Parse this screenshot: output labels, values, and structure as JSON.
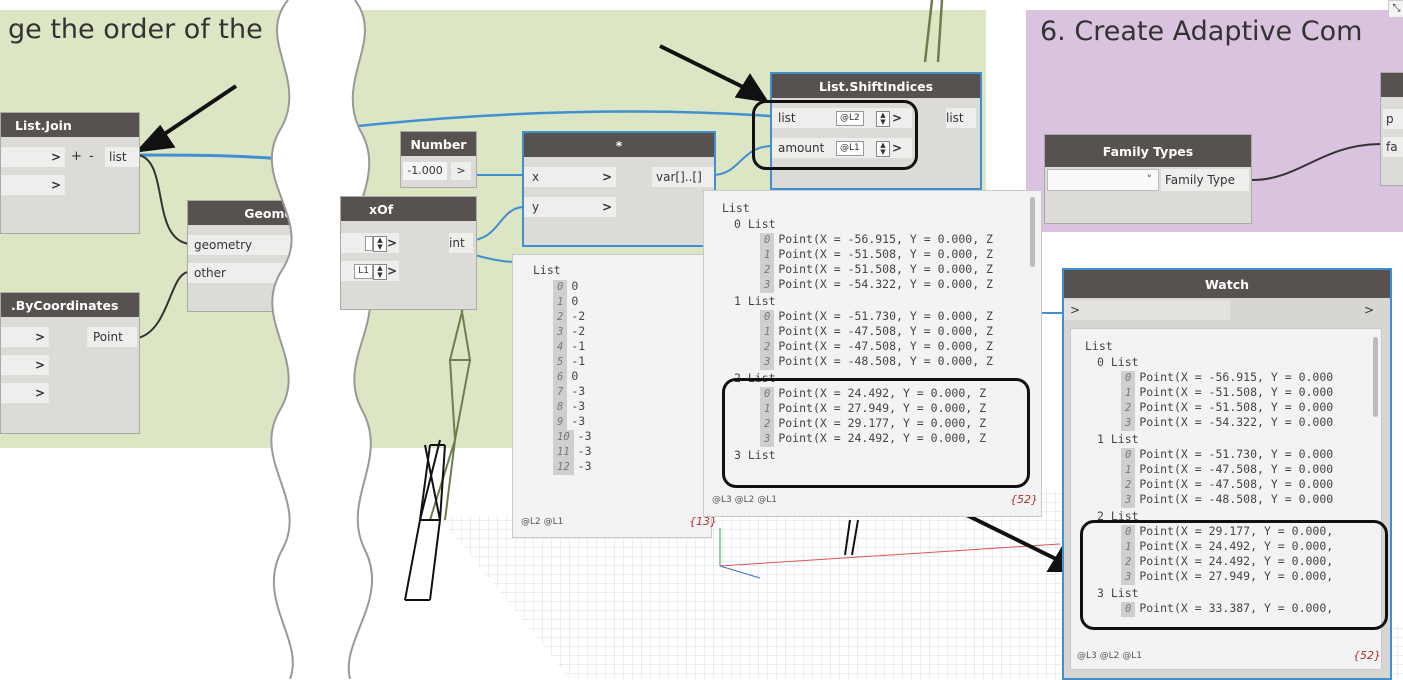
{
  "titles": {
    "left": "ge the order of the",
    "right": "6. Create Adaptive Com"
  },
  "colors": {
    "group_green": "#dde6c4",
    "group_purple": "#d9c3df",
    "node_header": "#575250",
    "wire": "#3f8fd1",
    "highlight": "#111111"
  },
  "nodes": {
    "list_join": {
      "title": "List.Join",
      "plus": "+",
      "minus": "-",
      "output": "list"
    },
    "geometry": {
      "title": "Geomet",
      "inputs": [
        "geometry",
        "other"
      ]
    },
    "by_coordinates": {
      "title": ".ByCoordinates",
      "output": "Point"
    },
    "number": {
      "title": "Number",
      "value": "-1.000",
      "output": ">"
    },
    "multiply": {
      "title": "*",
      "inputs": [
        "x",
        "y"
      ],
      "output": "var[]..[]"
    },
    "index_of": {
      "title": "xOf",
      "output": "int",
      "level_a": "",
      "level_b": "L1"
    },
    "shift_indices": {
      "title": "List.ShiftIndices",
      "inputs": [
        "list",
        "amount"
      ],
      "levels": [
        "@L2",
        "@L1"
      ],
      "output": "list"
    },
    "family_types": {
      "title": "Family Types",
      "value": "Family Type",
      "dropdown_icon": "chevron-down-icon"
    },
    "watch": {
      "title": "Watch",
      "in_port": ">",
      "out_port": ">"
    },
    "right_partial": {
      "ports": [
        "p",
        "fa"
      ]
    }
  },
  "watch_small": {
    "header": "List",
    "items": [
      {
        "i": "0",
        "v": "0"
      },
      {
        "i": "1",
        "v": "0"
      },
      {
        "i": "2",
        "v": "-2"
      },
      {
        "i": "3",
        "v": "-2"
      },
      {
        "i": "4",
        "v": "-1"
      },
      {
        "i": "5",
        "v": "-1"
      },
      {
        "i": "6",
        "v": "0"
      },
      {
        "i": "7",
        "v": "-3"
      },
      {
        "i": "8",
        "v": "-3"
      },
      {
        "i": "9",
        "v": "-3"
      },
      {
        "i": "10",
        "v": "-3"
      },
      {
        "i": "11",
        "v": "-3"
      },
      {
        "i": "12",
        "v": "-3"
      }
    ],
    "footer": "@L2 @L1",
    "count": "{13}"
  },
  "watch_mid": {
    "header": "List",
    "groups": [
      {
        "label": "0 List",
        "items": [
          {
            "i": "0",
            "v": "Point(X = -56.915, Y = 0.000, Z"
          },
          {
            "i": "1",
            "v": "Point(X = -51.508, Y = 0.000, Z"
          },
          {
            "i": "2",
            "v": "Point(X = -51.508, Y = 0.000, Z"
          },
          {
            "i": "3",
            "v": "Point(X = -54.322, Y = 0.000, Z"
          }
        ]
      },
      {
        "label": "1 List",
        "items": [
          {
            "i": "0",
            "v": "Point(X = -51.730, Y = 0.000, Z"
          },
          {
            "i": "1",
            "v": "Point(X = -47.508, Y = 0.000, Z"
          },
          {
            "i": "2",
            "v": "Point(X = -47.508, Y = 0.000, Z"
          },
          {
            "i": "3",
            "v": "Point(X = -48.508, Y = 0.000, Z"
          }
        ]
      },
      {
        "label": "2 List",
        "items": [
          {
            "i": "0",
            "v": "Point(X = 24.492, Y = 0.000, Z"
          },
          {
            "i": "1",
            "v": "Point(X = 27.949, Y = 0.000, Z"
          },
          {
            "i": "2",
            "v": "Point(X = 29.177, Y = 0.000, Z"
          },
          {
            "i": "3",
            "v": "Point(X = 24.492, Y = 0.000, Z"
          }
        ]
      },
      {
        "label": "3 List",
        "items": []
      }
    ],
    "footer": "@L3 @L2 @L1",
    "count": "{52}"
  },
  "watch_node": {
    "header": "List",
    "groups": [
      {
        "label": "0 List",
        "items": [
          {
            "i": "0",
            "v": "Point(X = -56.915, Y = 0.000"
          },
          {
            "i": "1",
            "v": "Point(X = -51.508, Y = 0.000"
          },
          {
            "i": "2",
            "v": "Point(X = -51.508, Y = 0.000"
          },
          {
            "i": "3",
            "v": "Point(X = -54.322, Y = 0.000"
          }
        ]
      },
      {
        "label": "1 List",
        "items": [
          {
            "i": "0",
            "v": "Point(X = -51.730, Y = 0.000"
          },
          {
            "i": "1",
            "v": "Point(X = -47.508, Y = 0.000"
          },
          {
            "i": "2",
            "v": "Point(X = -47.508, Y = 0.000"
          },
          {
            "i": "3",
            "v": "Point(X = -48.508, Y = 0.000"
          }
        ]
      },
      {
        "label": "2 List",
        "items": [
          {
            "i": "0",
            "v": "Point(X = 29.177, Y = 0.000,"
          },
          {
            "i": "1",
            "v": "Point(X = 24.492, Y = 0.000,"
          },
          {
            "i": "2",
            "v": "Point(X = 24.492, Y = 0.000,"
          },
          {
            "i": "3",
            "v": "Point(X = 27.949, Y = 0.000,"
          }
        ]
      },
      {
        "label": "3 List",
        "items": [
          {
            "i": "0",
            "v": "Point(X = 33.387, Y = 0.000,"
          }
        ]
      }
    ],
    "footer": "@L3 @L2 @L1",
    "count": "{52}"
  }
}
